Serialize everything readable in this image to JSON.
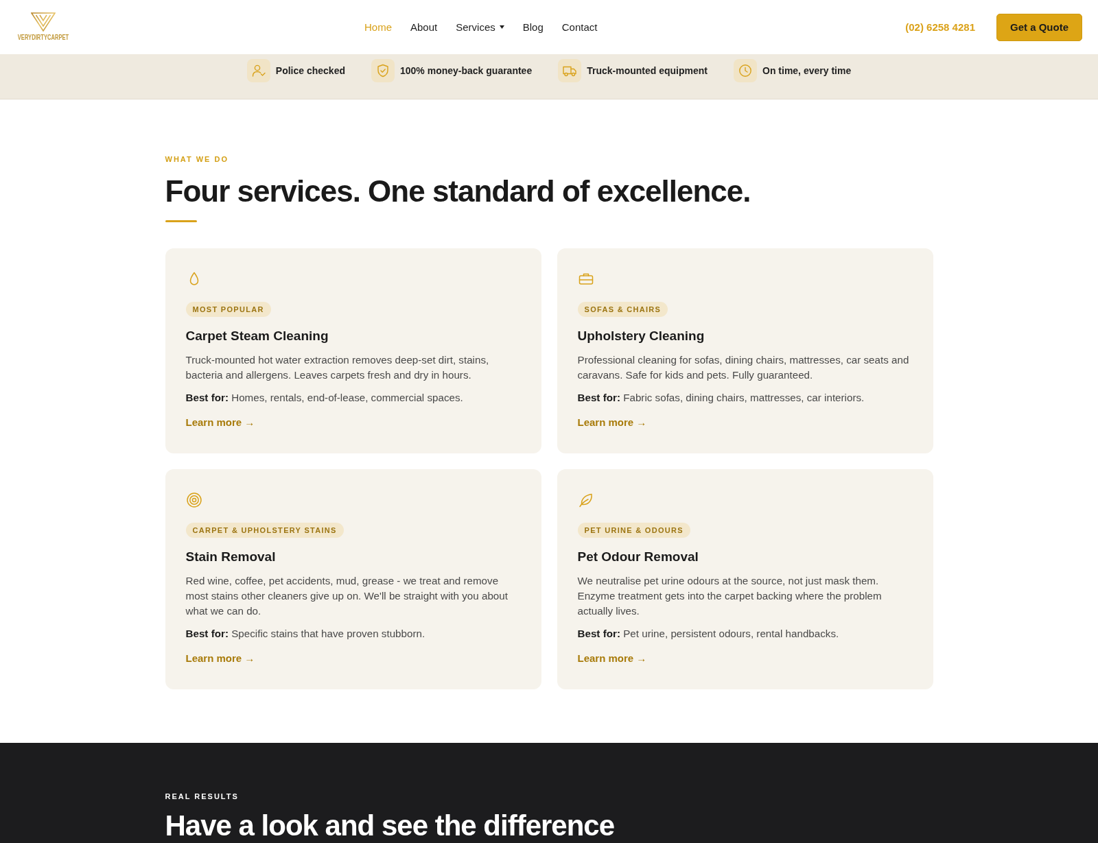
{
  "header": {
    "logo": {
      "text": "VERYDIRTYCARPET"
    },
    "nav": [
      {
        "label": "Home",
        "selected": true,
        "dropdown": false
      },
      {
        "label": "About",
        "selected": false,
        "dropdown": false
      },
      {
        "label": "Services",
        "selected": false,
        "dropdown": true
      },
      {
        "label": "Blog",
        "selected": false,
        "dropdown": false
      },
      {
        "label": "Contact",
        "selected": false,
        "dropdown": false
      }
    ],
    "phone": "(02) 6258 4281",
    "cta": "Get a Quote"
  },
  "trust_bar": {
    "items": [
      {
        "label": "Police checked"
      },
      {
        "label": "100% money-back guarantee"
      },
      {
        "label": "Truck-mounted equipment"
      },
      {
        "label": "On time, every time"
      }
    ]
  },
  "services": {
    "eyebrow": "WHAT WE DO",
    "heading": "Four services. One standard of excellence.",
    "cards": [
      {
        "tag": "MOST POPULAR",
        "title": "Carpet Steam Cleaning",
        "description": "Truck-mounted hot water extraction removes deep-set dirt, stains, bacteria and allergens. Leaves carpets fresh and dry in hours.",
        "best_for": "**Best for:** Homes, rentals, end-of-lease, commercial spaces.",
        "link": "Learn more →"
      },
      {
        "tag": "SOFAS & CHAIRS",
        "title": "Upholstery Cleaning",
        "description": "Professional cleaning for sofas, dining chairs, mattresses, car seats and caravans. Safe for kids and pets. Fully guaranteed.",
        "best_for": "**Best for:** Fabric sofas, dining chairs, mattresses, car interiors.",
        "link": "Learn more →"
      },
      {
        "tag": "CARPET & UPHOLSTERY STAINS",
        "title": "Stain Removal",
        "description": "Red wine, coffee, pet accidents, mud, grease - we treat and remove most stains other cleaners give up on. We'll be straight with you about what we can do.",
        "best_for": "**Best for:** Specific stains that have proven stubborn.",
        "link": "Learn more →"
      },
      {
        "tag": "PET URINE & ODOURS",
        "title": "Pet Odour Removal",
        "description": "We neutralise pet urine odours at the source, not just mask them. Enzyme treatment gets into the carpet backing where the problem actually lives.",
        "best_for": "**Best for:** Pet urine, persistent odours, rental handbacks.",
        "link": "Learn more →"
      }
    ]
  },
  "results": {
    "eyebrow": "REAL RESULTS",
    "heading": "Have a look and see the difference"
  }
}
